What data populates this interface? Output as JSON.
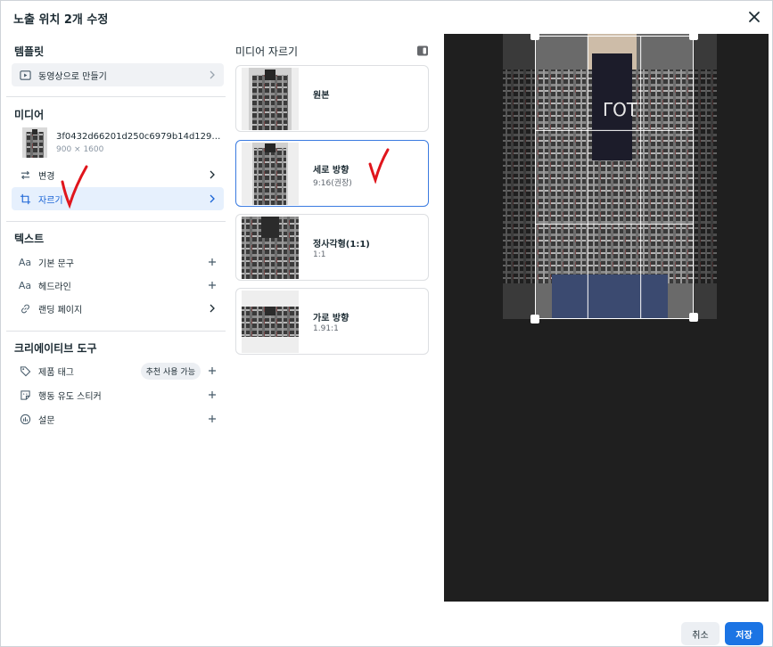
{
  "dialog": {
    "title": "노출 위치 2개 수정"
  },
  "template": {
    "heading": "템플릿",
    "item_label": "동영상으로 만들기"
  },
  "media": {
    "heading": "미디어",
    "file_name": "3f0432d66201d250c6979b14d129d5a...",
    "dimensions": "900 × 1600",
    "change_label": "변경",
    "crop_label": "자르기"
  },
  "text": {
    "heading": "텍스트",
    "primary_text": "기본 문구",
    "headline": "헤드라인",
    "landing_page": "랜딩 페이지"
  },
  "creative_tools": {
    "heading": "크리에이티브 도구",
    "product_tags": "제품 태그",
    "product_tags_badge": "추천 사용 가능",
    "sticker": "행동 유도 스티커",
    "poll": "설문"
  },
  "crop": {
    "heading": "미디어 자르기",
    "options": [
      {
        "name": "원본",
        "ratio": ""
      },
      {
        "name": "세로 방향",
        "ratio": "9:16(권장)"
      },
      {
        "name": "정사각형(1:1)",
        "ratio": "1:1"
      },
      {
        "name": "가로 방향",
        "ratio": "1.91:1"
      }
    ],
    "selected_index": 1
  },
  "footer": {
    "cancel_label": "취소",
    "save_label": "저장"
  },
  "colors": {
    "accent": "#1b74e4",
    "selected_border": "#3a7be0",
    "annotation_red": "#e0151c",
    "preview_bg": "#1f1f1f"
  }
}
